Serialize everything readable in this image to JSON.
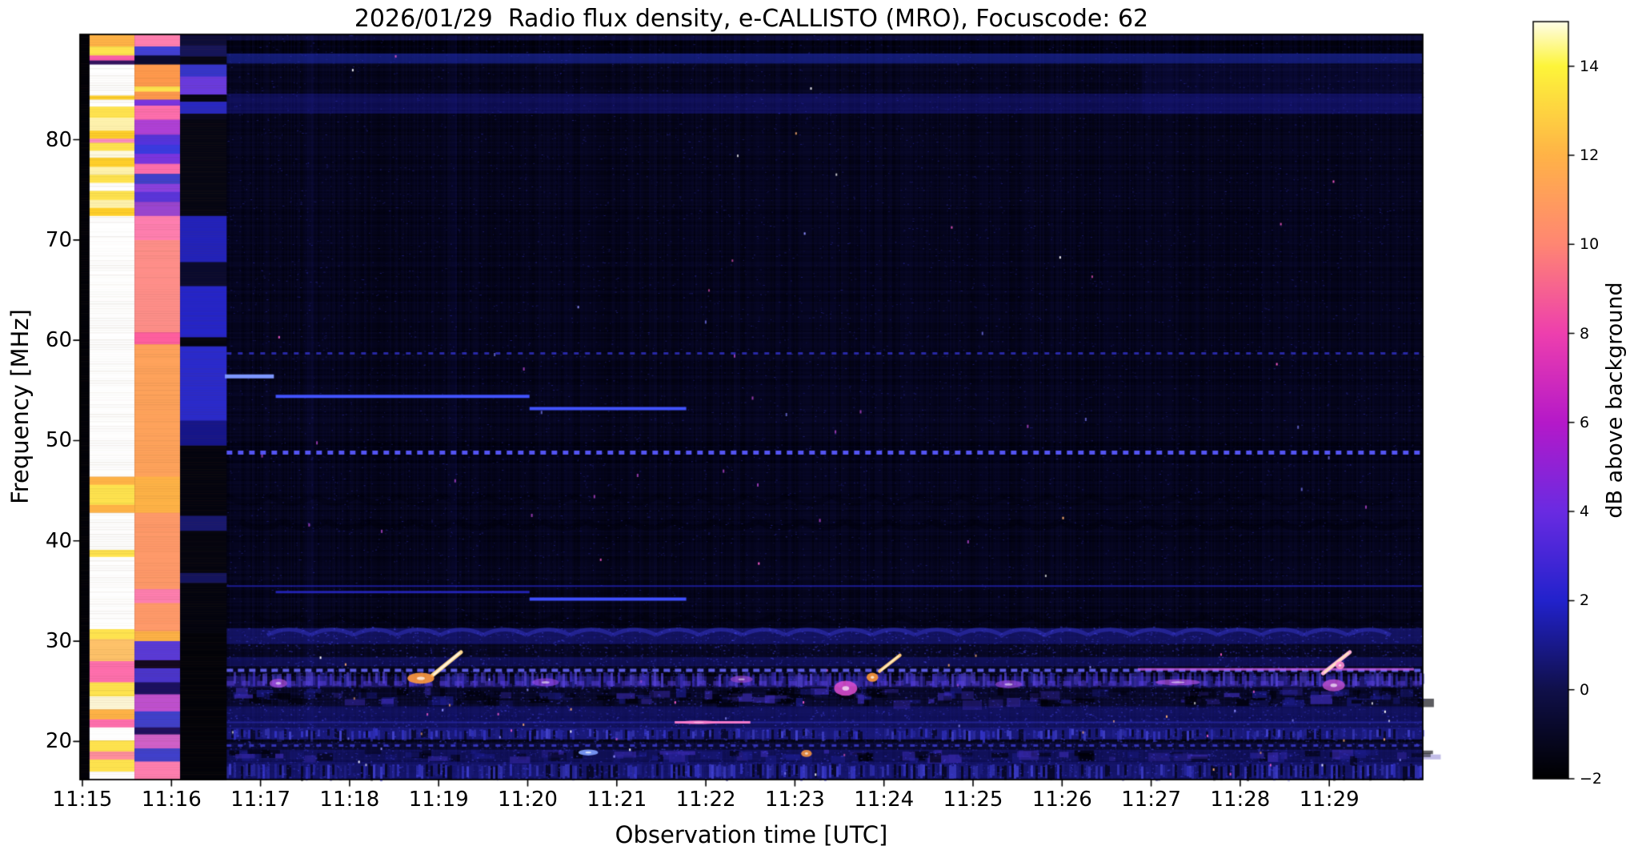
{
  "chart_data": {
    "type": "heatmap",
    "title": "2026/01/29  Radio flux density, e-CALLISTO (MRO), Focuscode: 62",
    "xlabel": "Observation time [UTC]",
    "ylabel": "Frequency [MHz]",
    "colorbar_label": "dB above background",
    "x_tick_labels": [
      "11:15",
      "11:16",
      "11:17",
      "11:18",
      "11:19",
      "11:20",
      "11:21",
      "11:22",
      "11:23",
      "11:24",
      "11:25",
      "11:26",
      "11:27",
      "11:28",
      "11:29"
    ],
    "y_tick_values": [
      20,
      30,
      40,
      50,
      60,
      70,
      80
    ],
    "freq_range_mhz": [
      16.2,
      90.5
    ],
    "time_range_min": [
      -0.03,
      15.05
    ],
    "grid": false,
    "colorbar": {
      "min": -2,
      "max": 15,
      "ticks": [
        {
          "value": -2,
          "label": "−2"
        },
        {
          "value": 0,
          "label": "0"
        },
        {
          "value": 2,
          "label": "2"
        },
        {
          "value": 4,
          "label": "4"
        },
        {
          "value": 6,
          "label": "6"
        },
        {
          "value": 8,
          "label": "8"
        },
        {
          "value": 10,
          "label": "10"
        },
        {
          "value": 12,
          "label": "12"
        },
        {
          "value": 14,
          "label": "14"
        }
      ],
      "gradient_stops": [
        [
          -2,
          "#000000"
        ],
        [
          0,
          "#10104a"
        ],
        [
          2,
          "#2222cc"
        ],
        [
          4,
          "#6a2be2"
        ],
        [
          6,
          "#b519c9"
        ],
        [
          8,
          "#ee3fae"
        ],
        [
          10,
          "#ff8673"
        ],
        [
          12,
          "#ffb347"
        ],
        [
          14,
          "#fdf53a"
        ],
        [
          15,
          "#fffde8"
        ]
      ]
    },
    "base_color": "#03030f",
    "calibration_columns": [
      {
        "t0": -0.03,
        "t1": 0.08,
        "bands": [
          [
            90.5,
            16.2,
            "#020208"
          ]
        ]
      },
      {
        "t0": 0.08,
        "t1": 0.585,
        "bands": [
          [
            90.5,
            89.3,
            "#ffb347"
          ],
          [
            89.3,
            88.4,
            "#ffe44f"
          ],
          [
            88.4,
            87.9,
            "#ff5fae"
          ],
          [
            87.9,
            87.5,
            "#31125e"
          ],
          [
            87.5,
            84.4,
            "#ffffff"
          ],
          [
            84.4,
            84.0,
            "#ffd02a"
          ],
          [
            84.0,
            83.3,
            "#ffffff"
          ],
          [
            83.3,
            82.2,
            "#ffe44f"
          ],
          [
            82.2,
            80.9,
            "#fff3ae"
          ],
          [
            80.9,
            80.1,
            "#ffd02a"
          ],
          [
            80.1,
            79.7,
            "#ff8fc0"
          ],
          [
            79.7,
            78.9,
            "#ffe44f"
          ],
          [
            78.9,
            78.2,
            "#fffbe0"
          ],
          [
            78.2,
            77.3,
            "#ffd02a"
          ],
          [
            77.3,
            76.5,
            "#fff3ae"
          ],
          [
            76.5,
            75.7,
            "#ffe44f"
          ],
          [
            75.7,
            74.9,
            "#ffffff"
          ],
          [
            74.9,
            74.0,
            "#ffe44f"
          ],
          [
            74.0,
            73.2,
            "#fff3ae"
          ],
          [
            73.2,
            72.4,
            "#ffd02a"
          ],
          [
            72.4,
            46.4,
            "#ffffff"
          ],
          [
            46.4,
            45.6,
            "#ffb347"
          ],
          [
            45.6,
            43.6,
            "#ffe44f"
          ],
          [
            43.6,
            42.8,
            "#ffb347"
          ],
          [
            42.8,
            39.1,
            "#ffffff"
          ],
          [
            39.1,
            38.4,
            "#ffe44f"
          ],
          [
            38.4,
            31.2,
            "#ffffff"
          ],
          [
            31.2,
            30.2,
            "#ffe44f"
          ],
          [
            30.2,
            28.0,
            "#ffc36a"
          ],
          [
            28.0,
            25.9,
            "#ff6fae"
          ],
          [
            25.9,
            24.5,
            "#ffe44f"
          ],
          [
            24.5,
            23.2,
            "#fff8d8"
          ],
          [
            23.2,
            22.2,
            "#ffb347"
          ],
          [
            22.2,
            21.4,
            "#ff6fae"
          ],
          [
            21.4,
            20.1,
            "#ffffff"
          ],
          [
            20.1,
            19.0,
            "#ffe44f"
          ],
          [
            19.0,
            18.2,
            "#ff8f9e"
          ],
          [
            18.2,
            17.0,
            "#ffe44f"
          ],
          [
            17.0,
            16.2,
            "#ffffff"
          ]
        ]
      },
      {
        "t0": 0.585,
        "t1": 1.097,
        "bands": [
          [
            90.5,
            89.3,
            "#ff7fb0"
          ],
          [
            89.3,
            88.4,
            "#4040d8"
          ],
          [
            88.4,
            87.5,
            "#0a0a30"
          ],
          [
            87.5,
            85.3,
            "#ff9a4d"
          ],
          [
            85.3,
            84.8,
            "#ffe44f"
          ],
          [
            84.8,
            84.0,
            "#ff9a4d"
          ],
          [
            84.0,
            83.4,
            "#7a35e0"
          ],
          [
            83.4,
            82.0,
            "#ff6fae"
          ],
          [
            82.0,
            80.5,
            "#b040d8"
          ],
          [
            80.5,
            79.5,
            "#5533dd"
          ],
          [
            79.5,
            78.6,
            "#3a3ae0"
          ],
          [
            78.6,
            77.6,
            "#7a35e0"
          ],
          [
            77.6,
            76.6,
            "#ff6fae"
          ],
          [
            76.6,
            75.6,
            "#4040cc"
          ],
          [
            75.6,
            74.8,
            "#8a40e0"
          ],
          [
            74.8,
            73.8,
            "#5a35d8"
          ],
          [
            73.8,
            72.4,
            "#9a45d0"
          ],
          [
            72.4,
            70.0,
            "#ff7fb0"
          ],
          [
            70.0,
            60.8,
            "#ff8f8a"
          ],
          [
            60.8,
            59.6,
            "#ff5fa0"
          ],
          [
            59.6,
            46.4,
            "#ffa35c"
          ],
          [
            46.4,
            42.8,
            "#ffb347"
          ],
          [
            42.8,
            35.2,
            "#ff9a6a"
          ],
          [
            35.2,
            33.8,
            "#ff7fb0"
          ],
          [
            33.8,
            31.0,
            "#ff9a6a"
          ],
          [
            31.0,
            30.0,
            "#ffb347"
          ],
          [
            30.0,
            28.1,
            "#5a3ad8"
          ],
          [
            28.1,
            27.3,
            "#14081f"
          ],
          [
            27.3,
            25.9,
            "#4a35cc"
          ],
          [
            25.9,
            24.7,
            "#1a1060"
          ],
          [
            24.7,
            23.0,
            "#c050d0"
          ],
          [
            23.0,
            21.4,
            "#4040cc"
          ],
          [
            21.4,
            20.7,
            "#201060"
          ],
          [
            20.7,
            19.3,
            "#d060c8"
          ],
          [
            19.3,
            18.0,
            "#4040cc"
          ],
          [
            18.0,
            16.2,
            "#ff7fb0"
          ]
        ]
      },
      {
        "t0": 1.097,
        "t1": 1.62,
        "bands": [
          [
            90.5,
            89.4,
            "#0d0d38"
          ],
          [
            89.4,
            88.3,
            "#15155a"
          ],
          [
            88.3,
            87.5,
            "#050514"
          ],
          [
            87.5,
            86.3,
            "#3535cc"
          ],
          [
            86.3,
            84.5,
            "#6a3ae0"
          ],
          [
            84.5,
            83.8,
            "#05050f"
          ],
          [
            83.8,
            82.6,
            "#2828c0"
          ],
          [
            82.6,
            82.0,
            "#08081e"
          ],
          [
            82.0,
            72.4,
            "#060612"
          ],
          [
            72.4,
            67.8,
            "#2222bb"
          ],
          [
            67.8,
            65.4,
            "#0a0a2e"
          ],
          [
            65.4,
            60.3,
            "#2525c8"
          ],
          [
            60.3,
            59.4,
            "#05050f"
          ],
          [
            59.4,
            52.0,
            "#2a2acc"
          ],
          [
            52.0,
            49.5,
            "#15158a"
          ],
          [
            49.5,
            42.5,
            "#04040e"
          ],
          [
            42.5,
            41.0,
            "#181870"
          ],
          [
            41.0,
            36.8,
            "#05050f"
          ],
          [
            36.8,
            35.8,
            "#14145e"
          ],
          [
            35.8,
            30.8,
            "#04040e"
          ],
          [
            30.8,
            16.2,
            "#030309"
          ]
        ]
      }
    ],
    "background_bands": [
      [
        90.5,
        89.9,
        "#0b0b30",
        1.0
      ],
      [
        89.9,
        88.6,
        "#010108",
        1.0
      ],
      [
        88.6,
        87.6,
        "#2233cc",
        0.5
      ],
      [
        84.6,
        82.6,
        "#1a1a96",
        0.45
      ],
      [
        49.8,
        47.8,
        "#010109",
        0.8
      ],
      [
        31.3,
        29.7,
        "#20209e",
        0.5
      ],
      [
        29.7,
        28.4,
        "#050517",
        0.9
      ],
      [
        28.4,
        27.5,
        "#12125a",
        0.8
      ],
      [
        26.5,
        25.4,
        "#2a1e8c",
        0.65
      ],
      [
        25.4,
        23.5,
        "#07071f",
        0.9
      ],
      [
        23.5,
        21.4,
        "#151570",
        0.7
      ],
      [
        21.4,
        20.2,
        "#1f1f92",
        0.75
      ],
      [
        19.9,
        19.2,
        "#0a0a2f",
        0.9
      ],
      [
        19.2,
        18.0,
        "#131360",
        0.8
      ],
      [
        18.0,
        16.2,
        "#181874",
        0.8
      ]
    ],
    "top_right_patch": {
      "t0": 11.9,
      "t1": 15.05,
      "f0": 87.5,
      "f1": 82.5,
      "color": "#2020b0",
      "alpha": 0.12
    },
    "spectral_lines": [
      {
        "f": 58.7,
        "t0": 1.62,
        "t1": 15.05,
        "dash": [
          6,
          8
        ],
        "color": "#3c3cf0",
        "alpha": 0.65,
        "w": 3
      },
      {
        "f": 48.8,
        "t0": 1.62,
        "t1": 15.05,
        "dash": [
          7,
          7
        ],
        "color": "#5858ff",
        "alpha": 0.95,
        "w": 5
      },
      {
        "f": 56.4,
        "t0": 1.6,
        "t1": 2.15,
        "color": "#7d97ff",
        "alpha": 1.0,
        "w": 5
      },
      {
        "f": 54.4,
        "t0": 2.17,
        "t1": 5.02,
        "color": "#4253ff",
        "alpha": 1.0,
        "w": 4
      },
      {
        "f": 53.2,
        "t0": 5.02,
        "t1": 6.78,
        "color": "#4253ff",
        "alpha": 1.0,
        "w": 4
      },
      {
        "f": 35.5,
        "t0": 1.62,
        "t1": 15.05,
        "color": "#2626c8",
        "alpha": 0.7,
        "w": 2
      },
      {
        "f": 34.9,
        "t0": 2.17,
        "t1": 5.02,
        "color": "#2b2bd8",
        "alpha": 0.8,
        "w": 3
      },
      {
        "f": 34.2,
        "t0": 5.02,
        "t1": 6.78,
        "color": "#3f4fff",
        "alpha": 1.0,
        "w": 4
      },
      {
        "f": 27.1,
        "t0": 1.62,
        "t1": 15.05,
        "dash": [
          8,
          6
        ],
        "color": "#6a6aff",
        "alpha": 0.85,
        "w": 4
      },
      {
        "f": 27.2,
        "t0": 11.85,
        "t1": 14.95,
        "color": "#c85ce8",
        "alpha": 0.8,
        "w": 3
      },
      {
        "f": 25.8,
        "t0": 1.62,
        "t1": 15.05,
        "dash": [
          10,
          9
        ],
        "color": "#5a3fe0",
        "alpha": 0.5,
        "w": 6
      },
      {
        "f": 21.9,
        "t0": 1.62,
        "t1": 15.05,
        "color": "#3a3ad8",
        "alpha": 0.45,
        "w": 2
      },
      {
        "f": 21.9,
        "t0": 6.65,
        "t1": 7.5,
        "color": "#ff7fd0",
        "alpha": 0.95,
        "w": 3
      },
      {
        "f": 19.6,
        "t0": 1.62,
        "t1": 15.05,
        "dash": [
          6,
          8
        ],
        "color": "#4444e8",
        "alpha": 0.7,
        "w": 3
      }
    ],
    "burst_streaks": [
      {
        "t0": 3.93,
        "f0": 26.6,
        "t1": 4.25,
        "f1": 28.9,
        "color": "#ffd890",
        "w": 5,
        "core": "#fff6e0"
      },
      {
        "t0": 8.95,
        "f0": 27.0,
        "t1": 9.18,
        "f1": 28.6,
        "color": "#ffc878",
        "w": 4,
        "core": "#ffefc8"
      },
      {
        "t0": 13.93,
        "f0": 26.8,
        "t1": 14.23,
        "f1": 28.9,
        "color": "#ffb0d8",
        "w": 5,
        "core": "#ffe8c0"
      }
    ],
    "bright_blobs": [
      {
        "t": 3.8,
        "f": 26.3,
        "w": 0.3,
        "h": 1.1,
        "color": "#ff9a3d",
        "alpha": 0.9
      },
      {
        "t": 8.87,
        "f": 26.4,
        "w": 0.13,
        "h": 0.9,
        "color": "#ff9a3d",
        "alpha": 0.9
      },
      {
        "t": 8.57,
        "f": 25.3,
        "w": 0.26,
        "h": 1.5,
        "color": "#e04fd0",
        "alpha": 0.85
      },
      {
        "t": 14.05,
        "f": 25.6,
        "w": 0.25,
        "h": 1.2,
        "color": "#c050d0",
        "alpha": 0.8
      },
      {
        "t": 14.12,
        "f": 27.6,
        "w": 0.1,
        "h": 0.8,
        "color": "#ff8fd0",
        "alpha": 0.9
      },
      {
        "t": 5.68,
        "f": 18.9,
        "w": 0.22,
        "h": 0.6,
        "color": "#7fa0ff",
        "alpha": 0.9
      },
      {
        "t": 8.13,
        "f": 18.8,
        "w": 0.12,
        "h": 0.7,
        "color": "#ff9a3d",
        "alpha": 0.85
      },
      {
        "t": 12.3,
        "f": 25.9,
        "w": 0.5,
        "h": 0.6,
        "color": "#a94fe0",
        "alpha": 0.7
      },
      {
        "t": 2.2,
        "f": 25.8,
        "w": 0.2,
        "h": 0.9,
        "color": "#b050e0",
        "alpha": 0.7
      },
      {
        "t": 5.2,
        "f": 25.9,
        "w": 0.3,
        "h": 0.8,
        "color": "#8a40d8",
        "alpha": 0.7
      },
      {
        "t": 7.4,
        "f": 26.2,
        "w": 0.25,
        "h": 0.7,
        "color": "#aa4fd8",
        "alpha": 0.6
      },
      {
        "t": 10.4,
        "f": 25.7,
        "w": 0.3,
        "h": 0.8,
        "color": "#9a48d8",
        "alpha": 0.65
      },
      {
        "t": 6.92,
        "f": 21.9,
        "w": 0.4,
        "h": 0.4,
        "color": "#ff7fd0",
        "alpha": 0.6
      }
    ],
    "vertical_stripes": [
      {
        "t": 2.56,
        "w": 8,
        "alpha": 0.07
      },
      {
        "t": 4.17,
        "w": 8,
        "alpha": 0.08
      },
      {
        "t": 8.78,
        "w": 6,
        "alpha": 0.06
      }
    ],
    "stripe_bands": [
      {
        "f0": 27.0,
        "f1": 25.5,
        "density": 0.55,
        "gapDensity": 0.28,
        "colors": [
          "#4434d0",
          "#5a4ae0",
          "#2a2a9e"
        ]
      },
      {
        "f0": 21.3,
        "f1": 20.2,
        "density": 0.45,
        "gapDensity": 0.18,
        "colors": [
          "#3a3ad8",
          "#5050e8",
          "#22228e"
        ]
      },
      {
        "f0": 17.8,
        "f1": 16.3,
        "density": 0.5,
        "gapDensity": 0.22,
        "colors": [
          "#3a3ad8",
          "#4a4ae8",
          "#20208a"
        ]
      }
    ],
    "mottle_bands": [
      {
        "f0": 25.4,
        "f1": 23.6,
        "count": 170
      },
      {
        "f0": 19.2,
        "f1": 18.0,
        "count": 120
      }
    ],
    "wavy_rows": [
      {
        "f": 44.5,
        "dark": true
      },
      {
        "f": 42.0,
        "dark": true
      },
      {
        "f": 32.5,
        "dark": true
      },
      {
        "f": 30.6,
        "dark": false
      }
    ],
    "noise": {
      "seed": 1234,
      "speckles": 12000,
      "low_band_speckles": 5000,
      "bright_specks": 80,
      "rfi_dots": 28
    }
  }
}
